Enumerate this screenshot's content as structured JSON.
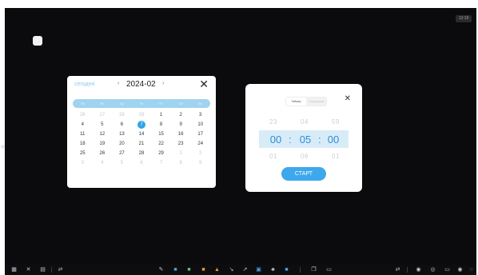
{
  "status": {
    "clock": "13:18"
  },
  "calendar": {
    "today_label": "сегодня",
    "month": "2024-02",
    "prev": "‹",
    "next": "›",
    "close": "✕",
    "weekdays": [
      "Пн",
      "Вт",
      "Ср",
      "Чт",
      "Пт",
      "Сб",
      "Вс"
    ],
    "days": [
      [
        "26",
        "27",
        "28",
        "29",
        "1",
        "2",
        "3"
      ],
      [
        "4",
        "5",
        "6",
        "7",
        "8",
        "9",
        "10"
      ],
      [
        "11",
        "12",
        "13",
        "14",
        "15",
        "16",
        "17"
      ],
      [
        "18",
        "19",
        "20",
        "21",
        "22",
        "23",
        "24"
      ],
      [
        "25",
        "26",
        "27",
        "28",
        "29",
        "1",
        "2"
      ],
      [
        "3",
        "4",
        "5",
        "6",
        "7",
        "8",
        "9"
      ]
    ],
    "selected": "7"
  },
  "timer": {
    "tab_timer": "Таймер",
    "tab_stopwatch": "Секундомер",
    "close": "✕",
    "above": [
      "23",
      "04",
      "59"
    ],
    "current": [
      "00",
      "05",
      "00"
    ],
    "below": [
      "01",
      "06",
      "01"
    ],
    "separator": ":",
    "start_label": "СТАРТ"
  },
  "colors": {
    "accent": "#33a3e6",
    "screen_bg": "#0b0b0d",
    "highlight_band": "#d8ecf8"
  },
  "taskbar": {
    "left_icons": [
      "apps-icon",
      "tools-icon",
      "grid-icon",
      "switch-icon"
    ],
    "center_icons": [
      "pen-icon",
      "notes-icon",
      "whiteboard-icon",
      "spotlight-icon",
      "eraser-icon",
      "brush-icon",
      "screenshot-icon",
      "share-icon",
      "files-icon",
      "timer-icon",
      "comment-icon"
    ],
    "right_icons": [
      "switch-icon",
      "back-icon",
      "home-icon",
      "menu-icon",
      "forward-icon",
      "settings-icon"
    ]
  }
}
